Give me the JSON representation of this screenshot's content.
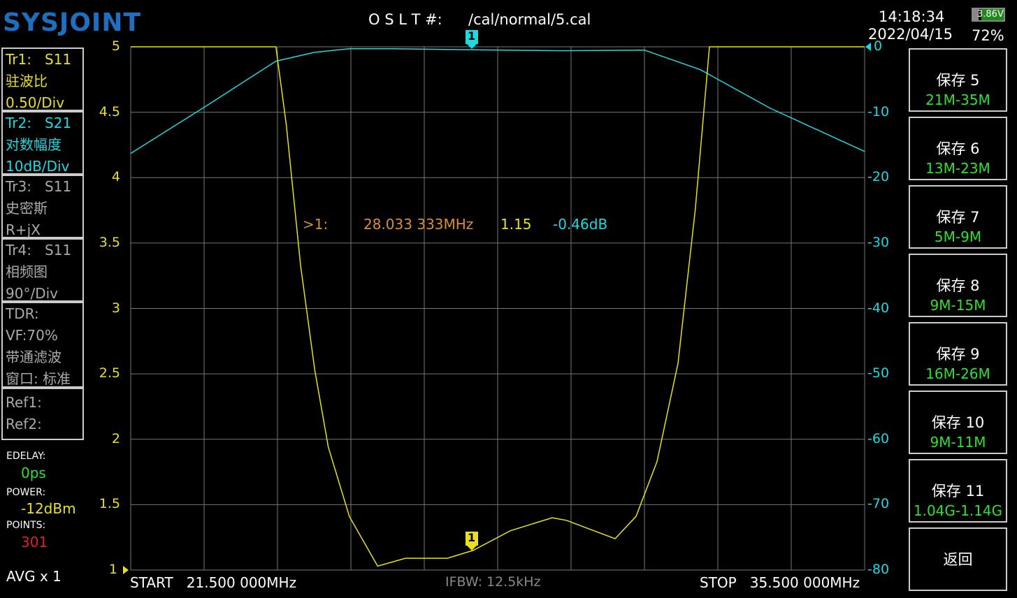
{
  "logo": "SYSJOINT",
  "header": {
    "cal_label": "O S L T #:",
    "cal_file": "/cal/normal/5.cal",
    "time": "14:18:34",
    "date": "2022/04/15",
    "battery_voltage": "3.86V",
    "battery_percent": "72%"
  },
  "traces": [
    {
      "name": "Tr1:   S11",
      "format": "驻波比",
      "scale": "0.50/Div",
      "color": "#e8e020"
    },
    {
      "name": "Tr2:   S21",
      "format": "对数幅度",
      "scale": "10dB/Div",
      "color": "#20d8e0"
    },
    {
      "name": "Tr3:   S11",
      "format": "史密斯",
      "scale": "R+jX",
      "color": "#aaaaaa"
    },
    {
      "name": "Tr4:   S11",
      "format": "相频图",
      "scale": "90°/Div",
      "color": "#aaaaaa"
    }
  ],
  "tdr": {
    "l1": "TDR:",
    "l2": "VF:70%",
    "l3": "带通滤波",
    "l4": "窗口: 标准"
  },
  "refs": {
    "r1": "Ref1:",
    "r2": "Ref2:"
  },
  "status": {
    "edelay_label": "EDELAY:",
    "edelay": "0ps",
    "power_label": "POWER:",
    "power": "-12dBm",
    "points_label": "POINTS:",
    "points": "301",
    "avg": "AVG x 1"
  },
  "footer": {
    "start": "START   21.500 000MHz",
    "ifbw": "IFBW: 12.5kHz",
    "stop": "STOP   35.500 000MHz"
  },
  "marker": {
    "label": ">1:",
    "freq": "28.033 333MHz",
    "swr": "1.15",
    "db": "-0.46dB",
    "id": "1"
  },
  "buttons": [
    {
      "title": "保存 5",
      "sub": "21M-35M"
    },
    {
      "title": "保存 6",
      "sub": "13M-23M"
    },
    {
      "title": "保存 7",
      "sub": "5M-9M"
    },
    {
      "title": "保存 8",
      "sub": "9M-15M"
    },
    {
      "title": "保存 9",
      "sub": "16M-26M"
    },
    {
      "title": "保存 10",
      "sub": "9M-11M"
    },
    {
      "title": "保存 11",
      "sub": "1.04G-1.14G"
    },
    {
      "title": "返回",
      "sub": ""
    }
  ],
  "chart_data": {
    "type": "line",
    "x_range_mhz": [
      21.5,
      35.5
    ],
    "y_left": {
      "range": [
        1,
        5
      ],
      "ticks": [
        "5",
        "4.5",
        "4",
        "3.5",
        "3",
        "2.5",
        "2",
        "1.5",
        "1"
      ]
    },
    "y_right": {
      "range": [
        -80,
        0
      ],
      "ticks": [
        "0",
        "-10",
        "-20",
        "-30",
        "-40",
        "-50",
        "-60",
        "-70",
        "-80"
      ]
    },
    "series": [
      {
        "name": "S11 SWR",
        "color": "#e8e020",
        "axis": "left",
        "x": [
          21.5,
          24.27,
          24.47,
          24.74,
          25.01,
          25.27,
          25.67,
          26.21,
          26.74,
          27.54,
          28.03,
          28.74,
          29.54,
          29.81,
          30.34,
          30.74,
          31.14,
          31.54,
          31.94,
          32.27,
          32.54,
          35.5
        ],
        "y": [
          5,
          5,
          4.4,
          3.33,
          2.53,
          1.94,
          1.41,
          1.03,
          1.09,
          1.09,
          1.15,
          1.3,
          1.4,
          1.38,
          1.3,
          1.24,
          1.41,
          1.83,
          2.58,
          3.76,
          5,
          5
        ]
      },
      {
        "name": "S21 LogMag",
        "color": "#20d8e0",
        "axis": "right",
        "x": [
          21.5,
          22.87,
          24.27,
          25.0,
          25.67,
          26.5,
          28.03,
          29.7,
          31.3,
          32.37,
          33.7,
          35.5
        ],
        "y": [
          -16.3,
          -9.4,
          -2.2,
          -0.85,
          -0.3,
          -0.3,
          -0.46,
          -0.6,
          -0.5,
          -3.5,
          -9.4,
          -16.0
        ]
      }
    ]
  }
}
